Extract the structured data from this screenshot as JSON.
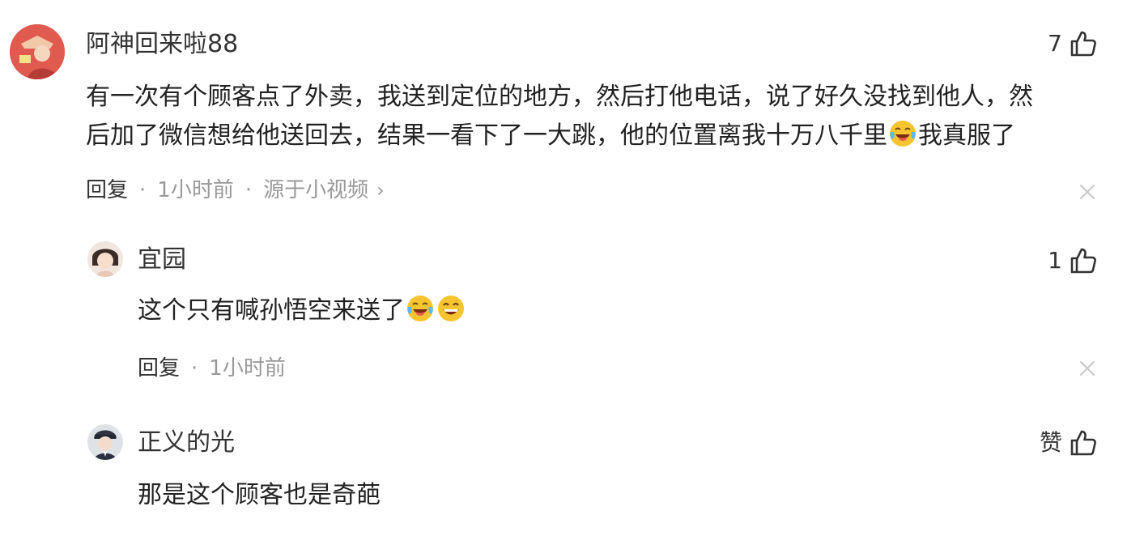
{
  "comments": [
    {
      "username": "阿神回来啦88",
      "like_count": "7",
      "lines": [
        "有一次有个顾客点了外卖，我送到定位的地方，然后打他电话，说了好久没找到他人，然",
        "后加了微信想给他送回去，结果一看下了一大跳，他的位置离我十万八千里",
        "我真服了"
      ],
      "emoji": [
        "laugh-cry-emoji"
      ],
      "reply_label": "回复",
      "separator": "·",
      "time": "1小时前",
      "source": "源于小视频",
      "source_chevron": "›"
    },
    {
      "username": "宜园",
      "like_count": "1",
      "text": "这个只有喊孙悟空来送了",
      "emoji": [
        "laugh-cry-emoji",
        "grin-emoji"
      ],
      "reply_label": "回复",
      "separator": "·",
      "time": "1小时前"
    },
    {
      "username": "正义的光",
      "like_count": "赞",
      "text": "那是这个顾客也是奇葩"
    }
  ],
  "colors": {
    "text": "#222222",
    "meta": "#999999",
    "close": "#c8c8c8",
    "emoji_face": "#f7c431"
  },
  "icons": {
    "like": "thumbs-up-icon",
    "dismiss": "close-icon"
  }
}
